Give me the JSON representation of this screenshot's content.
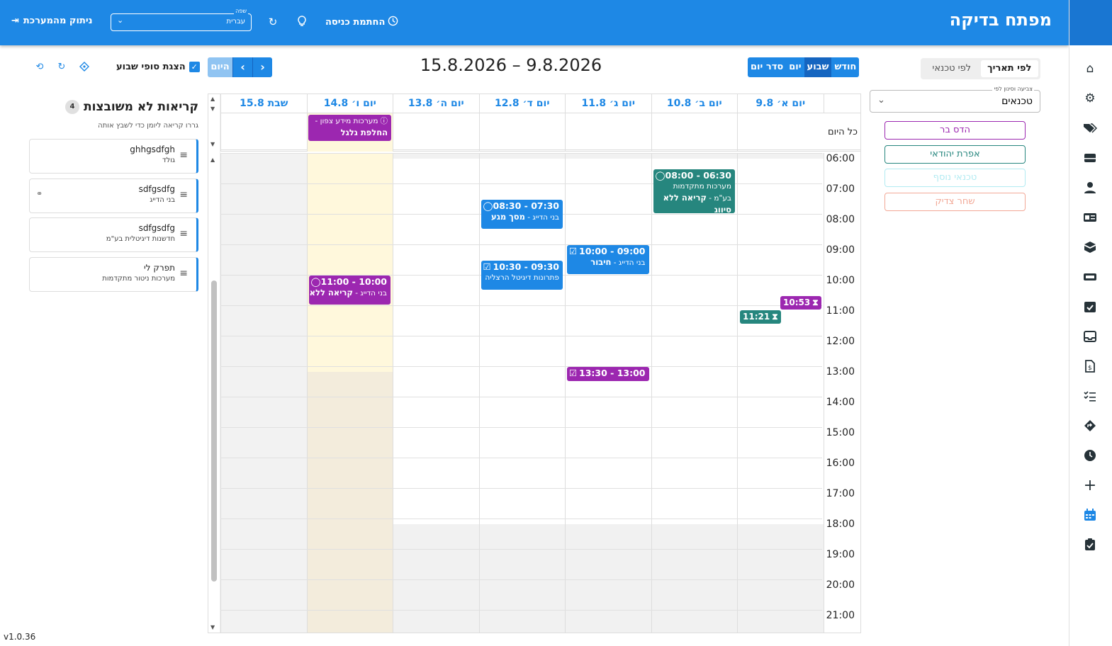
{
  "topbar": {
    "app_title": "מפתח בדיקה",
    "logout_label": "ניתוק מהמערכת",
    "language_caption": "שפה",
    "language_value": "עברית",
    "clockin_label": "החתמת כניסה"
  },
  "nav": {
    "icons": [
      "home-icon",
      "settings-icon",
      "tags-icon",
      "server-icon",
      "user-icon",
      "id-card-icon",
      "cube-icon",
      "ticket-icon",
      "task-check-icon",
      "inbox-icon",
      "invoice-icon",
      "checklist-icon",
      "directions-icon",
      "clock-icon",
      "plus-icon",
      "calendar-icon",
      "clipboard-check-icon"
    ]
  },
  "panel": {
    "mode_options": [
      "לפי תאריך",
      "לפי טכנאי"
    ],
    "mode_active": 0,
    "color_caption": "צביעה וסינון לפי",
    "color_value": "טכנאים",
    "technicians": [
      {
        "name": "הדס בר",
        "color": "#9c27b0"
      },
      {
        "name": "אפרת יהודאי",
        "color": "#26867e"
      },
      {
        "name": "טכנאי נוסף",
        "color": "#b2ebf2"
      },
      {
        "name": "שחר צדיק",
        "color": "#f2a896"
      }
    ]
  },
  "toolbar": {
    "views": [
      "חודש",
      "שבוע",
      "יום",
      "סדר יום"
    ],
    "active_view": 1,
    "title": "15.8.2026 – 9.8.2026",
    "today_label": "היום",
    "weekend_label": "הצגת סופי שבוע"
  },
  "calendar": {
    "days": [
      "יום א׳ 9.8",
      "יום ב׳ 10.8",
      "יום ג׳ 11.8",
      "יום ד׳ 12.8",
      "יום ה׳ 13.8",
      "יום ו׳ 14.8",
      "שבת 15.8"
    ],
    "allday_label": "כל היום",
    "hours": [
      "06:00",
      "07:00",
      "08:00",
      "09:00",
      "10:00",
      "11:00",
      "12:00",
      "13:00",
      "14:00",
      "15:00",
      "16:00",
      "17:00",
      "18:00",
      "19:00",
      "20:00",
      "21:00"
    ],
    "allday_event": {
      "line1": "מערכות מידע צפון -",
      "line2": "החלפת גלגל"
    },
    "events": [
      {
        "day": 1,
        "start": 6.5,
        "end": 8.0,
        "time": "06:30 - 08:00",
        "icon": "◯",
        "l1": "מערכות מתקדמות",
        "l2a": "בע\"מ - ",
        "l2b": "קריאה ללא",
        "l3": "סיווג",
        "color": "#26867e"
      },
      {
        "day": 3,
        "start": 7.5,
        "end": 8.5,
        "time": "07:30 - 08:30",
        "icon": "◯",
        "l1a": "בני הדייג - ",
        "l1b": "מסך מגע",
        "color": "#1e88e5"
      },
      {
        "day": 2,
        "start": 9.0,
        "end": 10.0,
        "time": "09:00 - 10:00",
        "icon": "☑",
        "l1a": "בני הדייג - ",
        "l1b": "חיבור",
        "color": "#1e88e5"
      },
      {
        "day": 3,
        "start": 9.5,
        "end": 10.5,
        "time": "09:30 - 10:30",
        "icon": "☑",
        "l1": "פתרונות דיגיטל הרצליה",
        "color": "#1e88e5"
      },
      {
        "day": 5,
        "start": 10.0,
        "end": 11.0,
        "time": "10:00 - 11:00",
        "icon": "◯",
        "l1a": "בני הדייג - ",
        "l1b": "קריאה ללא",
        "color": "#9c27b0"
      },
      {
        "day": 2,
        "start": 13.0,
        "end": 13.5,
        "time": "13:00 - 13:30",
        "icon": "☑",
        "color": "#9c27b0"
      }
    ],
    "chips": [
      {
        "label": "10:53",
        "color": "#9c27b0"
      },
      {
        "label": "11:21",
        "color": "#26867e"
      }
    ]
  },
  "unassigned": {
    "title": "קריאות לא משובצות",
    "count": "4",
    "hint": "גררו קריאה ליומן כדי לשבץ אותה",
    "items": [
      {
        "name": "ghhgsdfgh",
        "sub": "גולד"
      },
      {
        "name": "sdfgsdfg",
        "sub": "בני הדייג"
      },
      {
        "name": "sdfgsdfg",
        "sub": "חדשנות דיגיטלית בע\"מ"
      },
      {
        "name": "תפרק לי",
        "sub": "מערכות ניטור מתקדמות"
      }
    ]
  },
  "version": "v1.0.36"
}
